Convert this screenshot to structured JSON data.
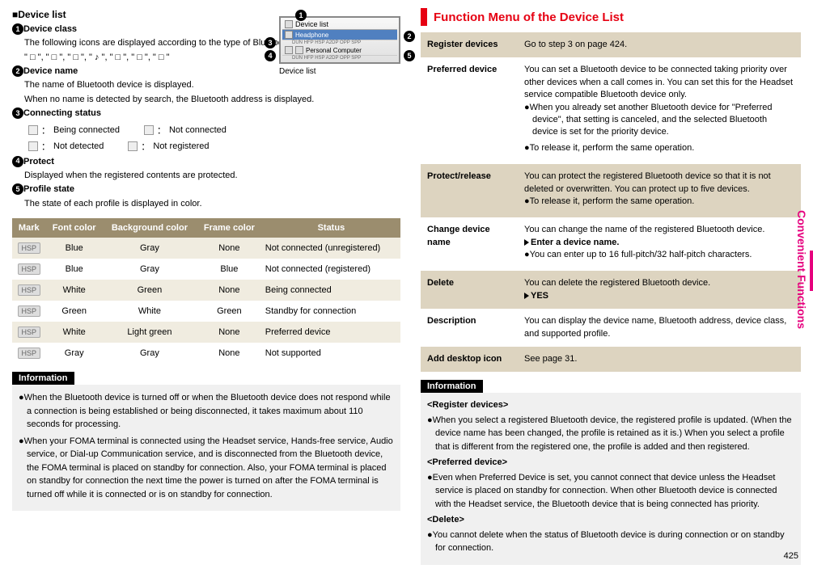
{
  "left": {
    "h_device_list": "■Device list",
    "s1": {
      "num": "1",
      "title": "Device class",
      "text": "The following icons are displayed according to the type of Bluetooth device:",
      "icons": "\" □ \", \" □ \", \" □ \", \" ♪ \", \" □ \", \" □ \", \" □ \""
    },
    "s2": {
      "num": "2",
      "title": "Device name",
      "text1": "The name of Bluetooth device is displayed.",
      "text2": "When no name is detected by search, the Bluetooth address is displayed."
    },
    "s3": {
      "num": "3",
      "title": "Connecting status",
      "a": "Being connected",
      "b": "Not connected",
      "c": "Not detected",
      "d": "Not registered"
    },
    "s4": {
      "num": "4",
      "title": "Protect",
      "text": "Displayed when the registered contents are protected."
    },
    "s5": {
      "num": "5",
      "title": "Profile state",
      "text": "The state of each profile is displayed in color."
    },
    "device_img_label": "Device list",
    "device_img": {
      "title": "Device list",
      "row1": "Headphone",
      "row2": "Personal Computer"
    },
    "table": {
      "headers": [
        "Mark",
        "Font color",
        "Background color",
        "Frame color",
        "Status"
      ],
      "rows": [
        [
          "HSP",
          "Blue",
          "Gray",
          "None",
          "Not connected (unregistered)"
        ],
        [
          "HSP",
          "Blue",
          "Gray",
          "Blue",
          "Not connected (registered)"
        ],
        [
          "HSP",
          "White",
          "Green",
          "None",
          "Being connected"
        ],
        [
          "HSP",
          "Green",
          "White",
          "Green",
          "Standby for connection"
        ],
        [
          "HSP",
          "White",
          "Light green",
          "None",
          "Preferred device"
        ],
        [
          "HSP",
          "Gray",
          "Gray",
          "None",
          "Not supported"
        ]
      ]
    },
    "info_label": "Information",
    "info": [
      "When the Bluetooth device is turned off or when the Bluetooth device does not respond while a connection is being established or being disconnected, it takes maximum about 110 seconds for processing.",
      "When your FOMA terminal is connected using the Headset service, Hands-free service, Audio service, or Dial-up Communication service, and is disconnected from the Bluetooth device, the FOMA terminal is placed on standby for connection. Also, your FOMA terminal is placed on standby for connection the next time the power is turned on after the FOMA terminal is turned off while it is connected or is on standby for connection."
    ]
  },
  "right": {
    "title": "Function Menu of the Device List",
    "rows": [
      {
        "k": "Register devices",
        "v": "Go to step 3 on page 424."
      },
      {
        "k": "Preferred device",
        "v": "You can set a Bluetooth device to be connected taking priority over other devices when a call comes in. You can set this for the Headset service compatible Bluetooth device only.",
        "bullets": [
          "When you already set another Bluetooth device for \"Preferred device\", that setting is canceled, and the selected Bluetooth device is set for the priority device.",
          "To release it, perform the same operation."
        ]
      },
      {
        "k": "Protect/release",
        "v": "You can protect the registered Bluetooth device so that it is not deleted or overwritten. You can protect up to five devices.",
        "bullets": [
          "To release it, perform the same operation."
        ]
      },
      {
        "k": "Change device name",
        "v": "You can change the name of the registered Bluetooth device.",
        "action": "Enter a device name.",
        "bullets": [
          "You can enter up to 16 full-pitch/32 half-pitch characters."
        ]
      },
      {
        "k": "Delete",
        "v": "You can delete the registered Bluetooth device.",
        "action": "YES"
      },
      {
        "k": "Description",
        "v": "You can display the device name, Bluetooth address, device class, and supported profile."
      },
      {
        "k": "Add desktop icon",
        "v": "See page 31."
      }
    ],
    "info_label": "Information",
    "info": {
      "h1": "<Register devices>",
      "b1": "When you select a registered Bluetooth device, the registered profile is updated. (When the device name has been changed, the profile is retained as it is.) When you select a profile that is different from the registered one, the profile is added and then registered.",
      "h2": "<Preferred device>",
      "b2": "Even when Preferred Device is set, you cannot connect that device unless the Headset service is placed on standby for connection. When other Bluetooth device is connected with the Headset service, the Bluetooth device that is being connected has priority.",
      "h3": "<Delete>",
      "b3": "You cannot delete when the status of Bluetooth device is during connection or on standby for connection."
    }
  },
  "sidebar": "Convenient Functions",
  "page": "425"
}
